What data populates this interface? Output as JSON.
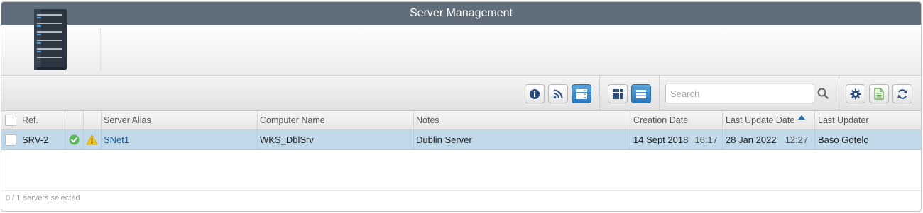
{
  "window": {
    "title": "Server Management"
  },
  "toolbar": {
    "buttons": [
      {
        "icon": "info-icon"
      },
      {
        "icon": "rss-icon"
      },
      {
        "icon": "server-view-icon",
        "active": true
      },
      {
        "icon": "grid-view-icon"
      },
      {
        "icon": "list-view-icon",
        "active": true
      },
      {
        "icon": "gear-icon"
      },
      {
        "icon": "export-document-icon"
      },
      {
        "icon": "refresh-icon"
      }
    ],
    "search": {
      "placeholder": "Search",
      "value": ""
    }
  },
  "grid": {
    "columns": {
      "ref": "Ref.",
      "alias": "Server Alias",
      "computer": "Computer Name",
      "notes": "Notes",
      "created": "Creation Date",
      "updated": "Last Update Date",
      "updater": "Last Updater"
    },
    "sort": {
      "column": "updated",
      "direction": "asc"
    },
    "rows": [
      {
        "ref": "SRV-2",
        "status": "ok",
        "warning": true,
        "alias": "SNet1",
        "computer": "WKS_DblSrv",
        "notes": "Dublin Server",
        "created_date": "14 Sept 2018",
        "created_time": "16:17",
        "updated_date": "28 Jan 2022",
        "updated_time": "12:27",
        "updater": "Baso Gotelo"
      }
    ]
  },
  "footer": {
    "selection": "0 / 1 servers selected"
  },
  "colors": {
    "titlebar": "#5f6e7a",
    "selected_row": "#c2d9ea",
    "accent": "#2a78bd",
    "ok": "#5cb85c",
    "warning": "#f0c419"
  }
}
